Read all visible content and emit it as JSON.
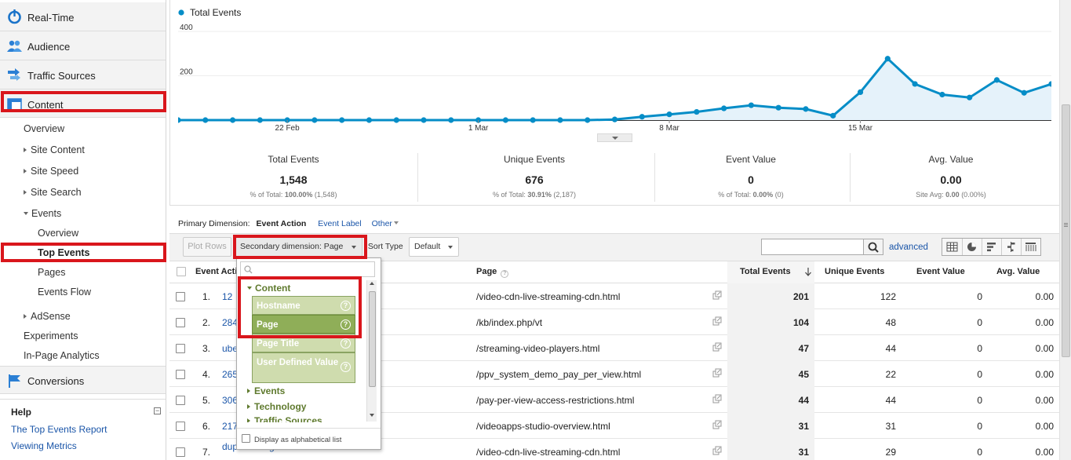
{
  "sidebar": {
    "realtime": "Real-Time",
    "audience": "Audience",
    "traffic_sources": "Traffic Sources",
    "content": "Content",
    "items": {
      "overview": "Overview",
      "site_content": "Site Content",
      "site_speed": "Site Speed",
      "site_search": "Site Search",
      "events": "Events",
      "events_overview": "Overview",
      "top_events": "Top Events",
      "pages": "Pages",
      "events_flow": "Events Flow",
      "adsense": "AdSense",
      "experiments": "Experiments",
      "in_page": "In-Page Analytics"
    },
    "conversions": "Conversions",
    "help": {
      "title": "Help",
      "link1": "The Top Events Report",
      "link2": "Viewing Metrics"
    }
  },
  "chart_data": {
    "type": "area",
    "legend": "Total Events",
    "color": "#058dc7",
    "y_ticks": [
      "400",
      "200"
    ],
    "ylim": [
      0,
      400
    ],
    "x_tick_labels": [
      "22 Feb",
      "1 Mar",
      "8 Mar",
      "15 Mar"
    ],
    "x_tick_index": [
      4,
      11,
      18,
      25
    ],
    "values": [
      0,
      0,
      0,
      0,
      0,
      0,
      0,
      0,
      0,
      0,
      0,
      0,
      0,
      0,
      0,
      0,
      3,
      15,
      26,
      37,
      53,
      67,
      56,
      50,
      20,
      126,
      277,
      163,
      115,
      102,
      181,
      123,
      163
    ]
  },
  "scorecards": [
    {
      "title": "Total Events",
      "value": "1,548",
      "sub_pre": "% of Total: ",
      "sub_bold": "100.00%",
      "sub_post": " (1,548)"
    },
    {
      "title": "Unique Events",
      "value": "676",
      "sub_pre": "% of Total: ",
      "sub_bold": "30.91%",
      "sub_post": " (2,187)"
    },
    {
      "title": "Event Value",
      "value": "0",
      "sub_pre": "% of Total: ",
      "sub_bold": "0.00%",
      "sub_post": " (0)"
    },
    {
      "title": "Avg. Value",
      "value": "0.00",
      "sub_pre": "Site Avg: ",
      "sub_bold": "0.00",
      "sub_post": " (0.00%)"
    }
  ],
  "dimension_bar": {
    "label": "Primary Dimension:",
    "active": "Event Action",
    "link": "Event Label",
    "other": "Other"
  },
  "toolbar": {
    "plot_rows": "Plot Rows",
    "secondary": "Secondary dimension: Page",
    "sort_label": "Sort Type:",
    "sort_value": "Default",
    "advanced": "advanced"
  },
  "table": {
    "headers": {
      "event_action": "Event Acti",
      "page": "Page",
      "total_events": "Total Events",
      "unique_events": "Unique Events",
      "event_value": "Event Value",
      "avg_value": "Avg. Value"
    },
    "rows": [
      {
        "n": "1.",
        "action": "12",
        "page": "/video-cdn-live-streaming-cdn.html",
        "total": "201",
        "unique": "122",
        "value": "0",
        "avg": "0.00"
      },
      {
        "n": "2.",
        "action": "284",
        "page": "/kb/index.php/vt",
        "total": "104",
        "unique": "48",
        "value": "0",
        "avg": "0.00"
      },
      {
        "n": "3.",
        "action": "ube",
        "page": "/streaming-video-players.html",
        "total": "47",
        "unique": "44",
        "value": "0",
        "avg": "0.00"
      },
      {
        "n": "4.",
        "action": "265",
        "page": "/ppv_system_demo_pay_per_view.html",
        "total": "45",
        "unique": "22",
        "value": "0",
        "avg": "0.00"
      },
      {
        "n": "5.",
        "action": "306",
        "page": "/pay-per-view-access-restrictions.html",
        "total": "44",
        "unique": "44",
        "value": "0",
        "avg": "0.00"
      },
      {
        "n": "6.",
        "action": "217",
        "page": "/videoapps-studio-overview.html",
        "total": "31",
        "unique": "31",
        "value": "0",
        "avg": "0.00"
      },
      {
        "n": "7.",
        "action": "dupr5036lugo",
        "page": "/video-cdn-live-streaming-cdn.html",
        "total": "31",
        "unique": "29",
        "value": "0",
        "avg": "0.00"
      }
    ]
  },
  "dropdown": {
    "category_content": "Content",
    "hostname": "Hostname",
    "page": "Page",
    "page_title": "Page Title",
    "user_defined": "User Defined Value",
    "category_events": "Events",
    "category_technology": "Technology",
    "category_traffic": "Traffic Sources",
    "alpha_label": "Display as alphabetical list"
  }
}
